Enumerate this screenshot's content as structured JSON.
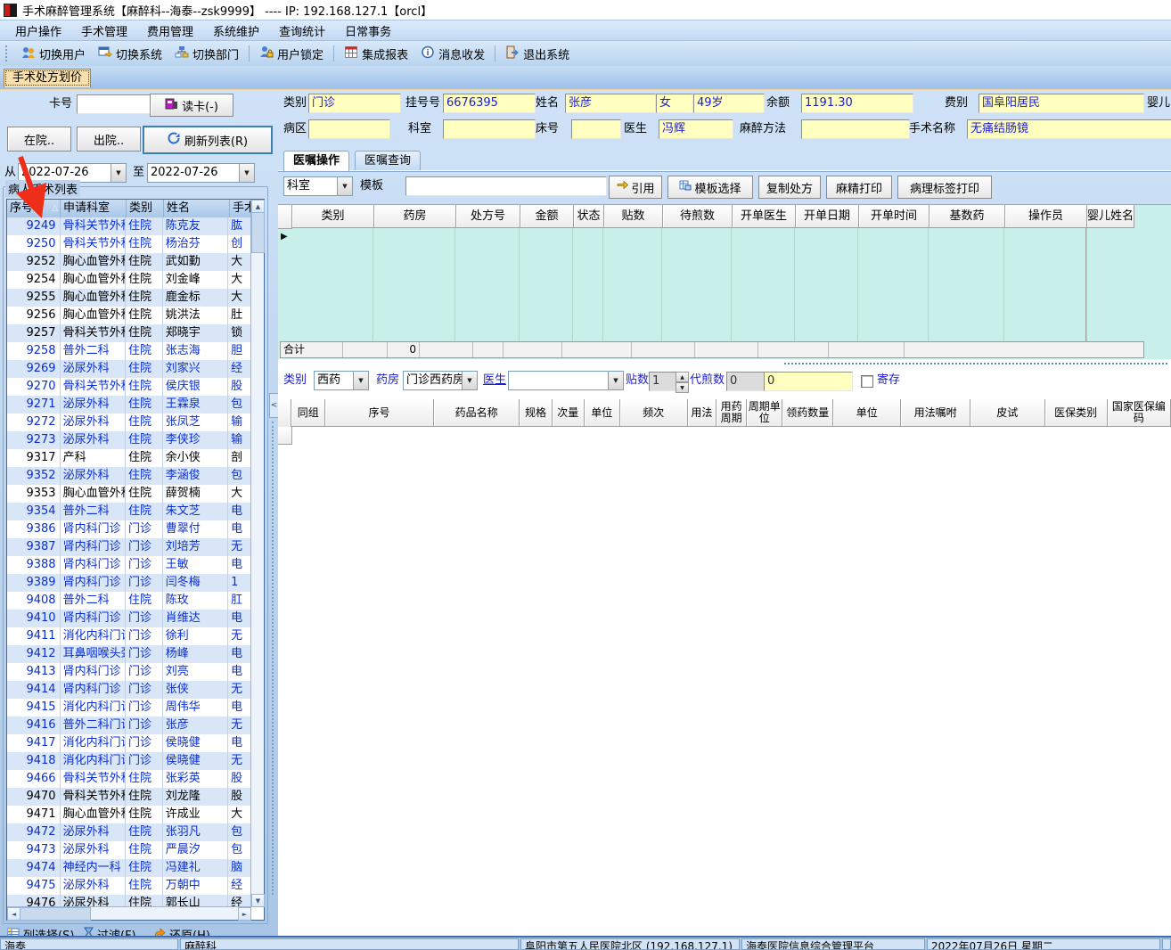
{
  "window": {
    "title": "手术麻醉管理系统【麻醉科--海泰--zsk9999】 ----  IP:  192.168.127.1【orcl】"
  },
  "menu": {
    "items": [
      {
        "label": "用户操作"
      },
      {
        "label": "手术管理"
      },
      {
        "label": "费用管理"
      },
      {
        "label": "系统维护"
      },
      {
        "label": "查询统计"
      },
      {
        "label": "日常事务"
      }
    ]
  },
  "toolbar": {
    "buttons": [
      {
        "label": "切换用户"
      },
      {
        "label": "切换系统"
      },
      {
        "label": "切换部门"
      },
      {
        "label": "用户锁定"
      },
      {
        "label": "集成报表"
      },
      {
        "label": "消息收发"
      },
      {
        "label": "退出系统"
      }
    ]
  },
  "tabs": {
    "active": "手术处方划价"
  },
  "left": {
    "card_label": "卡号",
    "card_value": "",
    "read_card": "读卡(-)",
    "btn_in": "在院..",
    "btn_out": "出院..",
    "btn_refresh": "刷新列表(R)",
    "from_label": "从",
    "from_date": "2022-07-26",
    "to_label": "至",
    "to_date": "2022-07-26",
    "group_title": "病人手术列表",
    "headers": [
      "序号",
      "申请科室",
      "类别",
      "姓名",
      "手术名称"
    ],
    "rows": [
      {
        "no": "9249",
        "dept": "骨科关节外科",
        "type": "住院",
        "name": "陈克友",
        "op": "肱",
        "variant": "blue"
      },
      {
        "no": "9250",
        "dept": "骨科关节外科",
        "type": "住院",
        "name": "杨治芬",
        "op": "创",
        "variant": "blue"
      },
      {
        "no": "9252",
        "dept": "胸心血管外科",
        "type": "住院",
        "name": "武如勤",
        "op": "大",
        "variant": "black"
      },
      {
        "no": "9254",
        "dept": "胸心血管外科",
        "type": "住院",
        "name": "刘金峰",
        "op": "大",
        "variant": "black"
      },
      {
        "no": "9255",
        "dept": "胸心血管外科",
        "type": "住院",
        "name": "鹿金标",
        "op": "大",
        "variant": "black"
      },
      {
        "no": "9256",
        "dept": "胸心血管外科",
        "type": "住院",
        "name": "姚洪法",
        "op": "肚",
        "variant": "black"
      },
      {
        "no": "9257",
        "dept": "骨科关节外科",
        "type": "住院",
        "name": "郑晓宇",
        "op": "锁",
        "variant": "black"
      },
      {
        "no": "9258",
        "dept": "普外二科",
        "type": "住院",
        "name": "张志海",
        "op": "胆",
        "variant": "blue"
      },
      {
        "no": "9269",
        "dept": "泌尿外科",
        "type": "住院",
        "name": "刘家兴",
        "op": "经",
        "variant": "blue"
      },
      {
        "no": "9270",
        "dept": "骨科关节外科",
        "type": "住院",
        "name": "侯庆银",
        "op": "股",
        "variant": "blue"
      },
      {
        "no": "9271",
        "dept": "泌尿外科",
        "type": "住院",
        "name": "王霖泉",
        "op": "包",
        "variant": "blue"
      },
      {
        "no": "9272",
        "dept": "泌尿外科",
        "type": "住院",
        "name": "张凤芝",
        "op": "输",
        "variant": "blue"
      },
      {
        "no": "9273",
        "dept": "泌尿外科",
        "type": "住院",
        "name": "李侠珍",
        "op": "输",
        "variant": "blue"
      },
      {
        "no": "9317",
        "dept": "产科",
        "type": "住院",
        "name": "余小侠",
        "op": "剖",
        "variant": "black"
      },
      {
        "no": "9352",
        "dept": "泌尿外科",
        "type": "住院",
        "name": "李涵俊",
        "op": "包",
        "variant": "blue"
      },
      {
        "no": "9353",
        "dept": "胸心血管外科",
        "type": "住院",
        "name": "薛贺楠",
        "op": "大",
        "variant": "black"
      },
      {
        "no": "9354",
        "dept": "普外二科",
        "type": "住院",
        "name": "朱文芝",
        "op": "电",
        "variant": "blue"
      },
      {
        "no": "9386",
        "dept": "肾内科门诊",
        "type": "门诊",
        "name": "曹翠付",
        "op": "电",
        "variant": "blue"
      },
      {
        "no": "9387",
        "dept": "肾内科门诊",
        "type": "门诊",
        "name": "刘培芳",
        "op": "无",
        "variant": "blue"
      },
      {
        "no": "9388",
        "dept": "肾内科门诊",
        "type": "门诊",
        "name": "王敏",
        "op": "电",
        "variant": "blue"
      },
      {
        "no": "9389",
        "dept": "肾内科门诊",
        "type": "门诊",
        "name": "闫冬梅",
        "op": "1",
        "variant": "blue"
      },
      {
        "no": "9408",
        "dept": "普外二科",
        "type": "住院",
        "name": "陈玫",
        "op": "肛",
        "variant": "blue"
      },
      {
        "no": "9410",
        "dept": "肾内科门诊",
        "type": "门诊",
        "name": "肖维达",
        "op": "电",
        "variant": "blue"
      },
      {
        "no": "9411",
        "dept": "消化内科门诊",
        "type": "门诊",
        "name": "徐利",
        "op": "无",
        "variant": "blue"
      },
      {
        "no": "9412",
        "dept": "耳鼻咽喉头颈外科",
        "type": "门诊",
        "name": "杨峰",
        "op": "电",
        "variant": "blue"
      },
      {
        "no": "9413",
        "dept": "肾内科门诊",
        "type": "门诊",
        "name": "刘亮",
        "op": "电",
        "variant": "blue"
      },
      {
        "no": "9414",
        "dept": "肾内科门诊",
        "type": "门诊",
        "name": "张侠",
        "op": "无",
        "variant": "blue"
      },
      {
        "no": "9415",
        "dept": "消化内科门诊",
        "type": "门诊",
        "name": "周伟华",
        "op": "电",
        "variant": "blue"
      },
      {
        "no": "9416",
        "dept": "普外二科门诊",
        "type": "门诊",
        "name": "张彦",
        "op": "无",
        "variant": "blue"
      },
      {
        "no": "9417",
        "dept": "消化内科门诊",
        "type": "门诊",
        "name": "侯晓健",
        "op": "电",
        "variant": "blue"
      },
      {
        "no": "9418",
        "dept": "消化内科门诊",
        "type": "门诊",
        "name": "侯晓健",
        "op": "无",
        "variant": "blue"
      },
      {
        "no": "9466",
        "dept": "骨科关节外科",
        "type": "住院",
        "name": "张彩英",
        "op": "股",
        "variant": "blue"
      },
      {
        "no": "9470",
        "dept": "骨科关节外科",
        "type": "住院",
        "name": "刘龙隆",
        "op": "股",
        "variant": "black"
      },
      {
        "no": "9471",
        "dept": "胸心血管外科",
        "type": "住院",
        "name": "许成业",
        "op": "大",
        "variant": "black"
      },
      {
        "no": "9472",
        "dept": "泌尿外科",
        "type": "住院",
        "name": "张羽凡",
        "op": "包",
        "variant": "blue"
      },
      {
        "no": "9473",
        "dept": "泌尿外科",
        "type": "住院",
        "name": "严晨汐",
        "op": "包",
        "variant": "blue"
      },
      {
        "no": "9474",
        "dept": "神经内一科",
        "type": "住院",
        "name": "冯建礼",
        "op": "脑",
        "variant": "blue"
      },
      {
        "no": "9475",
        "dept": "泌尿外科",
        "type": "住院",
        "name": "万朝中",
        "op": "经",
        "variant": "blue"
      },
      {
        "no": "9476",
        "dept": "泌尿外科",
        "type": "住院",
        "name": "郭长山",
        "op": "经",
        "variant": "black"
      }
    ],
    "btn_columns": "列选择(S)",
    "btn_filter": "过滤(F)",
    "btn_restore": "还原(H)"
  },
  "patient": {
    "type_label": "类别",
    "type": "门诊",
    "regno_label": "挂号号",
    "regno": "6676395",
    "name_label": "姓名",
    "name": "张彦",
    "sex": "女",
    "age": "49岁",
    "balance_label": "余额",
    "balance": "1191.30",
    "fee_label": "费别",
    "fee": "国阜阳居民",
    "baby_label": "婴儿",
    "ward_label": "病区",
    "ward": "",
    "dept_label": "科室",
    "dept": "",
    "bed_label": "床号",
    "bed": "",
    "doctor_label": "医生",
    "doctor": "冯辉",
    "anesthesia_label": "麻醉方法",
    "anesthesia": "",
    "operation_label": "手术名称",
    "operation": "无痛结肠镜"
  },
  "orders": {
    "tab_operate": "医嘱操作",
    "tab_query": "医嘱查询",
    "dept_combo": "科室",
    "template_label": "模板",
    "template_value": "",
    "btn_cite": "引用",
    "btn_template": "模板选择",
    "btn_copy": "复制处方",
    "btn_narcotic": "麻精打印",
    "btn_pathology": "病理标签打印",
    "rx_headers": [
      "类别",
      "药房",
      "处方号",
      "金额",
      "状态",
      "贴数",
      "待煎数",
      "开单医生",
      "开单日期",
      "开单时间",
      "基数药",
      "操作员",
      "婴儿姓名"
    ],
    "total_label": "合计",
    "total_amount": "0",
    "controls": {
      "type_label": "类别",
      "type": "西药",
      "pharmacy_label": "药房",
      "pharmacy": "门诊西药房",
      "doctor_label": "医生",
      "doctor": "",
      "paste_label": "贴数",
      "paste": "1",
      "decoct_label": "代煎数",
      "decoct": "0",
      "decoct2": "0",
      "deposit_label": "寄存"
    },
    "med_headers": [
      "同组",
      "序号",
      "药品名称",
      "规格",
      "次量",
      "单位",
      "频次",
      "用法",
      "用药周期",
      "周期单位",
      "领药数量",
      "单位",
      "用法嘱咐",
      "皮试",
      "医保类别",
      "国家医保编码"
    ]
  },
  "status": {
    "segments": [
      "海泰",
      "麻醉科",
      "阜阳市第五人民医院北区 (192.168.127.1)",
      "海泰医院信息综合管理平台",
      "2022年07月26日 星期二",
      ""
    ]
  },
  "colors": {
    "field_yellow": "#ffffc0",
    "grid_cyan": "#c8efe9",
    "record_blue": "#0a2ed2",
    "annotation_red": "#ee2e18"
  }
}
